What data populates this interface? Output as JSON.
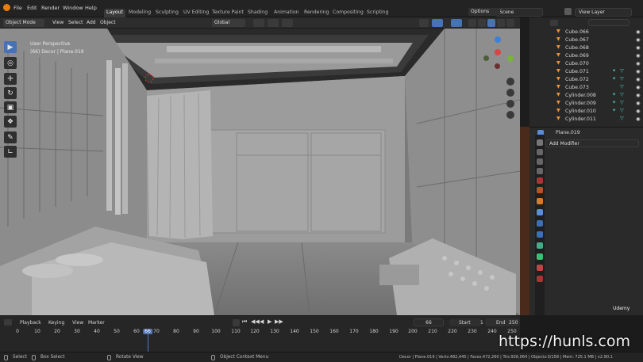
{
  "menu": [
    "File",
    "Edit",
    "Render",
    "Window",
    "Help"
  ],
  "workspaces": [
    {
      "label": "Layout",
      "active": true
    },
    {
      "label": "Modeling"
    },
    {
      "label": "Sculpting"
    },
    {
      "label": "UV Editing"
    },
    {
      "label": "Texture Paint"
    },
    {
      "label": "Shading"
    },
    {
      "label": "Animation"
    },
    {
      "label": "Rendering"
    },
    {
      "label": "Compositing"
    },
    {
      "label": "Scripting"
    }
  ],
  "scene": {
    "label": "Scene",
    "view_layer": "View Layer"
  },
  "viewport_header": {
    "mode": "Object Mode",
    "menus": [
      "View",
      "Select",
      "Add",
      "Object"
    ],
    "orientation": "Global",
    "options": "Options"
  },
  "viewport": {
    "perspective_label": "User Perspective",
    "object_label": "(66) Decor | Plane.019"
  },
  "tools": [
    "select-box",
    "cursor",
    "move",
    "rotate",
    "scale",
    "transform",
    "annotate",
    "measure"
  ],
  "outliner": {
    "items": [
      "Cube.066",
      "Cube.067",
      "Cube.068",
      "Cube.069",
      "Cube.070",
      "Cube.071",
      "Cube.072",
      "Cube.073",
      "Cylinder.008",
      "Cylinder.009",
      "Cylinder.010",
      "Cylinder.011"
    ]
  },
  "properties": {
    "object_name": "Plane.019",
    "add_modifier": "Add Modifier"
  },
  "timeline": {
    "menus": [
      "Playback",
      "Keying",
      "View",
      "Marker"
    ],
    "current_frame": "66",
    "start_label": "Start",
    "start": "1",
    "end_label": "End",
    "end": "250",
    "ticks": [
      "0",
      "10",
      "20",
      "30",
      "40",
      "50",
      "60",
      "66",
      "70",
      "80",
      "90",
      "100",
      "110",
      "120",
      "130",
      "140",
      "150",
      "160",
      "170",
      "180",
      "190",
      "200",
      "210",
      "220",
      "230",
      "240",
      "250"
    ]
  },
  "status": {
    "select": "Select",
    "box_select": "Box Select",
    "rotate_view": "Rotate View",
    "context_menu": "Object Context Menu",
    "stats": "Decor | Plane.019 | Verts:482,445 | Faces:472,260 | Tris:936,064 | Objects:0/158 | Mem: 725.1 MB | v2.90.1"
  },
  "watermark": "https://hunls.com",
  "udemy": "Udemy",
  "colors": {
    "accent": "#4772b3",
    "mesh_orange": "#e8923a",
    "modifier_cyan": "#4fc7c5",
    "active_frame": "#4a78c5"
  }
}
